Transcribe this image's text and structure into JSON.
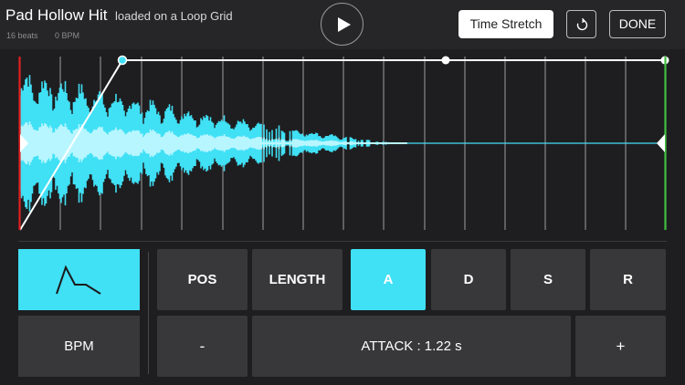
{
  "header": {
    "sample_name": "Pad Hollow Hit",
    "loaded_on": "loaded on a Loop Grid",
    "beats": "16 beats",
    "bpm": "0 BPM"
  },
  "toolbar": {
    "time_stretch_label": "Time Stretch",
    "done_label": "DONE"
  },
  "colors": {
    "accent": "#40e0f5",
    "start_marker": "#e02020",
    "end_marker": "#40c040",
    "panel": "#38383a"
  },
  "icons": [
    "play-icon",
    "reset-icon",
    "envelope-icon"
  ],
  "modes": {
    "bpm_label": "BPM"
  },
  "tabs": [
    {
      "label": "POS",
      "active": false
    },
    {
      "label": "LENGTH",
      "active": false
    },
    {
      "label": "A",
      "active": true
    },
    {
      "label": "D",
      "active": false
    },
    {
      "label": "S",
      "active": false
    },
    {
      "label": "R",
      "active": false
    }
  ],
  "stepper": {
    "minus_label": "-",
    "value_text": "ATTACK : 1.22 s",
    "plus_label": "+"
  }
}
